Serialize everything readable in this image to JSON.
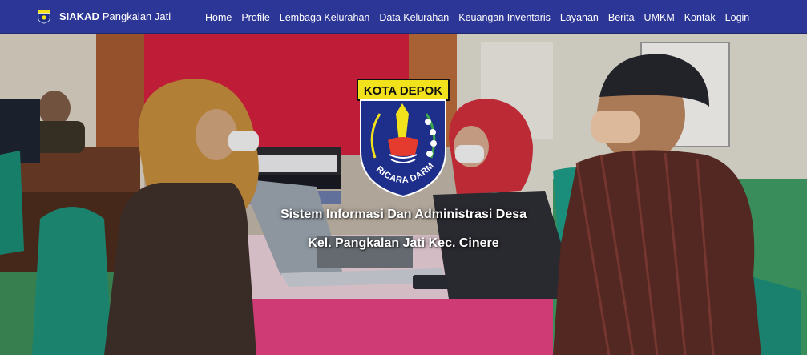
{
  "brand": {
    "name_strong": "SIAKAD",
    "name_rest": "Pangkalan Jati",
    "logo_icon": "kota-depok-emblem-icon"
  },
  "nav": {
    "items": [
      {
        "label": "Home"
      },
      {
        "label": "Profile"
      },
      {
        "label": "Lembaga Kelurahan"
      },
      {
        "label": "Data Kelurahan"
      },
      {
        "label": "Keuangan Inventaris"
      },
      {
        "label": "Layanan"
      },
      {
        "label": "Berita"
      },
      {
        "label": "UMKM"
      },
      {
        "label": "Kontak"
      },
      {
        "label": "Login"
      }
    ]
  },
  "hero": {
    "emblem": {
      "top_text": "KOTA DEPOK",
      "motto": "PARICARA DARMA"
    },
    "title": "Sistem Informasi Dan Administrasi Desa",
    "subtitle": "Kel. Pangkalan Jati Kec. Cinere"
  },
  "colors": {
    "navbar": "#2c3696",
    "emblem_blue": "#1d2f8a",
    "emblem_yellow": "#f2e21c"
  }
}
